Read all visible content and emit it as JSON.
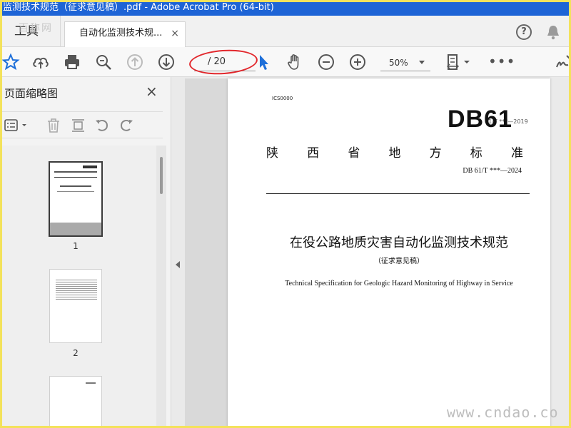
{
  "window": {
    "title": "监测技术规范（征求意见稿）.pdf - Adobe Acrobat Pro (64-bit)"
  },
  "tabs": {
    "tools_label": "工具",
    "tools_watermark": "百称网",
    "document_label": "自动化监测技术规...",
    "close_glyph": "×",
    "help_glyph": "?"
  },
  "toolbar": {
    "page_indicator": "/ 20",
    "zoom_value": "50%",
    "more_glyph": "•••"
  },
  "thumbnails_panel": {
    "title": "页面缩略图",
    "close_glyph": "×",
    "pages": [
      {
        "label": "1",
        "selected": true
      },
      {
        "label": "2",
        "selected": false
      }
    ]
  },
  "document": {
    "ics": "ICS0000",
    "db": "DB61",
    "db_faint": "61/T ***—2019",
    "province_chars": [
      "陕",
      "西",
      "省",
      "地",
      "方",
      "标",
      "准"
    ],
    "standard_number": "DB 61/T ***—2024",
    "main_title": "在役公路地质灾害自动化监测技术规范",
    "subtitle": "（征求意见稿）",
    "english_title": "Technical Specification for Geologic Hazard Monitoring of Highway in Service"
  },
  "watermark": {
    "site": "www.cndao.co"
  },
  "colors": {
    "titlebar": "#1e64d6",
    "highlight_ring": "#e2282d",
    "frame": "#f3e25b",
    "accent_icon": "#1e6fd9"
  }
}
